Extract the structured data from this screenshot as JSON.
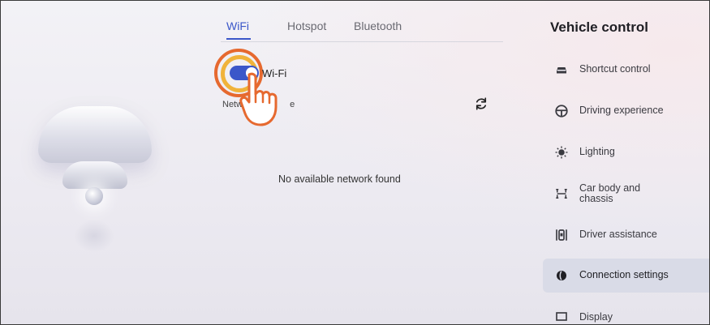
{
  "tabs": [
    {
      "label": "WiFi",
      "active": true
    },
    {
      "label": "Hotspot",
      "active": false
    },
    {
      "label": "Bluetooth",
      "active": false
    }
  ],
  "wifi": {
    "toggle_label": "Wi-Fi",
    "toggle_on": true,
    "network_label": "Netw",
    "network_label_tail": "e",
    "empty_message": "No available network found"
  },
  "panel": {
    "title": "Vehicle control",
    "items": [
      {
        "label": "Shortcut control",
        "icon": "car-icon"
      },
      {
        "label": "Driving experience",
        "icon": "steering-wheel-icon"
      },
      {
        "label": "Lighting",
        "icon": "light-bulb-icon"
      },
      {
        "label": "Car body and chassis",
        "icon": "chassis-icon"
      },
      {
        "label": "Driver assistance",
        "icon": "driver-assistance-icon"
      },
      {
        "label": "Connection settings",
        "icon": "connection-icon",
        "active": true
      },
      {
        "label": "Display",
        "icon": "display-icon"
      }
    ]
  },
  "colors": {
    "accent": "#3b57c9",
    "ring_outer": "#e6692f",
    "ring_inner": "#f0b33b"
  }
}
